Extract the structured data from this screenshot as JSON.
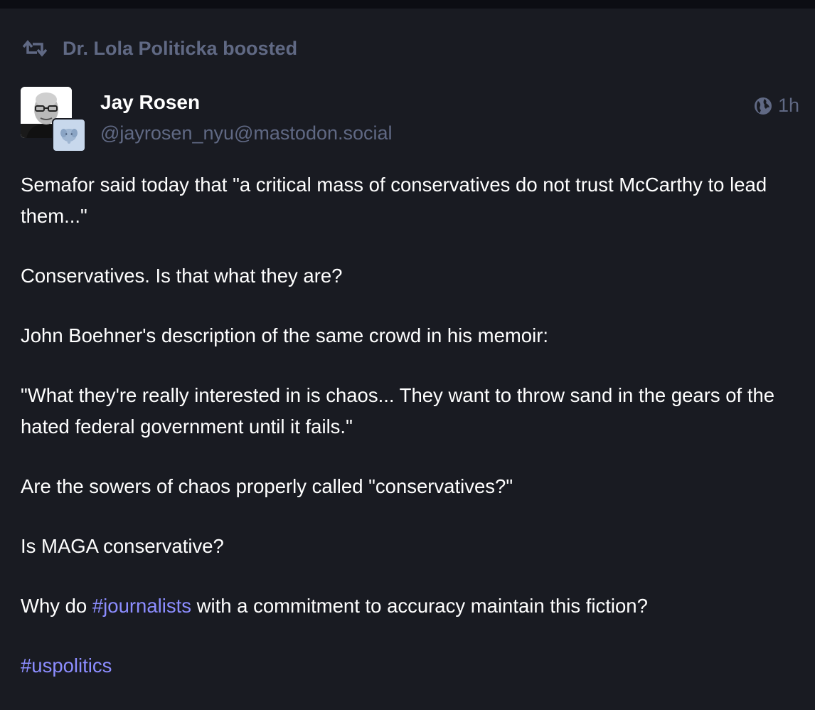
{
  "boost": {
    "label": "Dr. Lola Politicka boosted",
    "icon": "retweet-icon"
  },
  "author": {
    "display_name": "Jay Rosen",
    "handle": "@jayrosen_nyu@mastodon.social"
  },
  "meta": {
    "visibility_icon": "globe-icon",
    "time": "1h"
  },
  "content": {
    "p1": "Semafor said today that \"a critical mass of conservatives do not trust McCarthy to lead them...\"",
    "p2": "Conservatives. Is that what they are?",
    "p3": "John Boehner's description of the same crowd in his memoir:",
    "p4": "\"What they're really interested in is chaos... They want to throw sand in the gears of the hated federal government until it fails.\"",
    "p5": "Are the sowers of chaos properly called \"conservatives?\"",
    "p6": "Is MAGA conservative?",
    "p7_before": "Why do ",
    "p7_tag": "#journalists",
    "p7_after": " with a commitment to accuracy maintain this fiction?",
    "p8_tag": "#uspolitics"
  },
  "colors": {
    "background": "#191b22",
    "muted": "#606984",
    "text": "#ffffff"
  }
}
